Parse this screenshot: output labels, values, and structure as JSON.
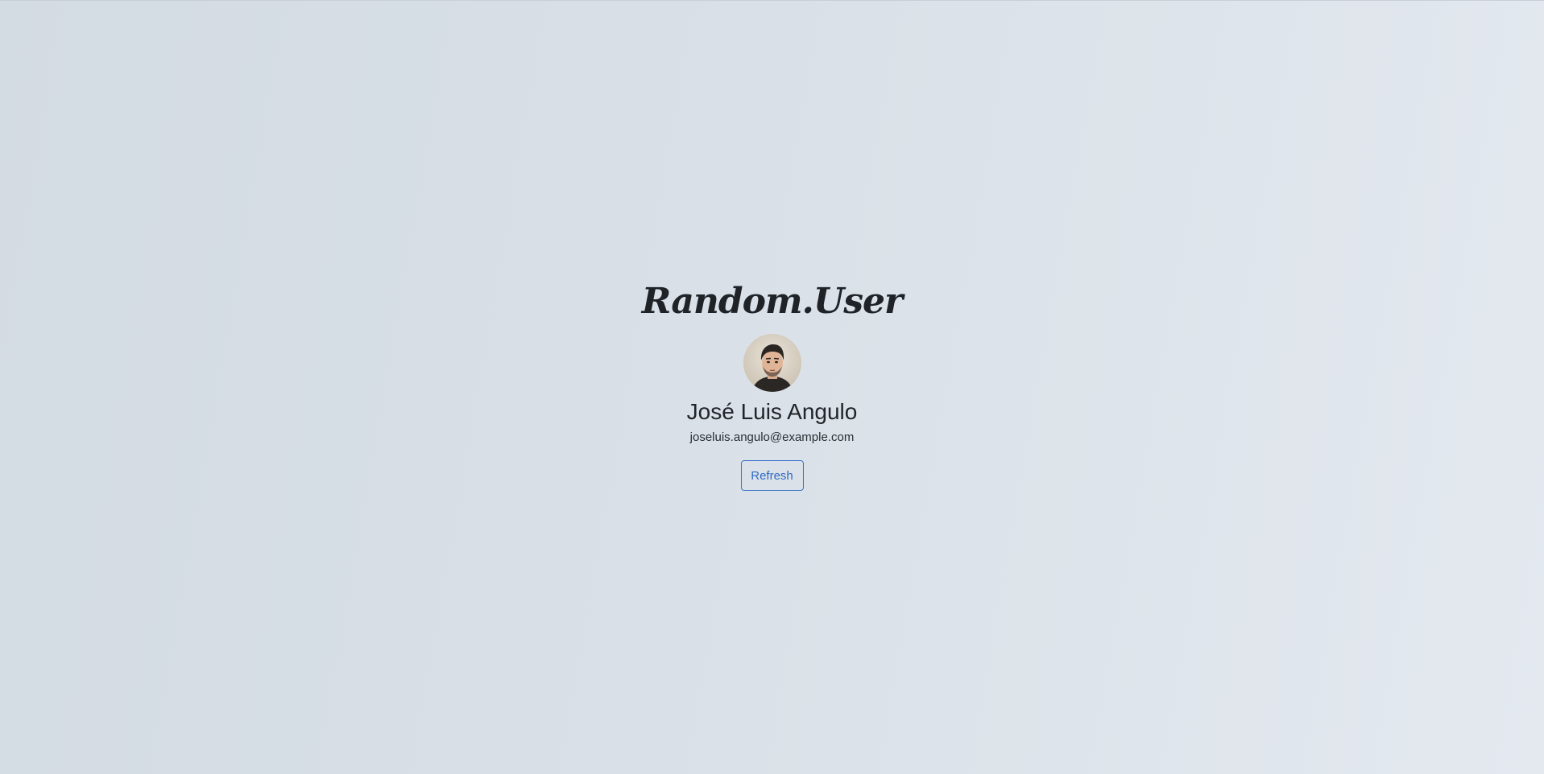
{
  "brand": {
    "title": "Random.User"
  },
  "user": {
    "name": "José Luis Angulo",
    "email": "joseluis.angulo@example.com",
    "avatar_icon": "person-portrait"
  },
  "actions": {
    "refresh_label": "Refresh"
  },
  "colors": {
    "accent": "#2f6bc4",
    "text": "#212529",
    "background_start": "#d3dbe3",
    "background_end": "#e3e9ef"
  }
}
